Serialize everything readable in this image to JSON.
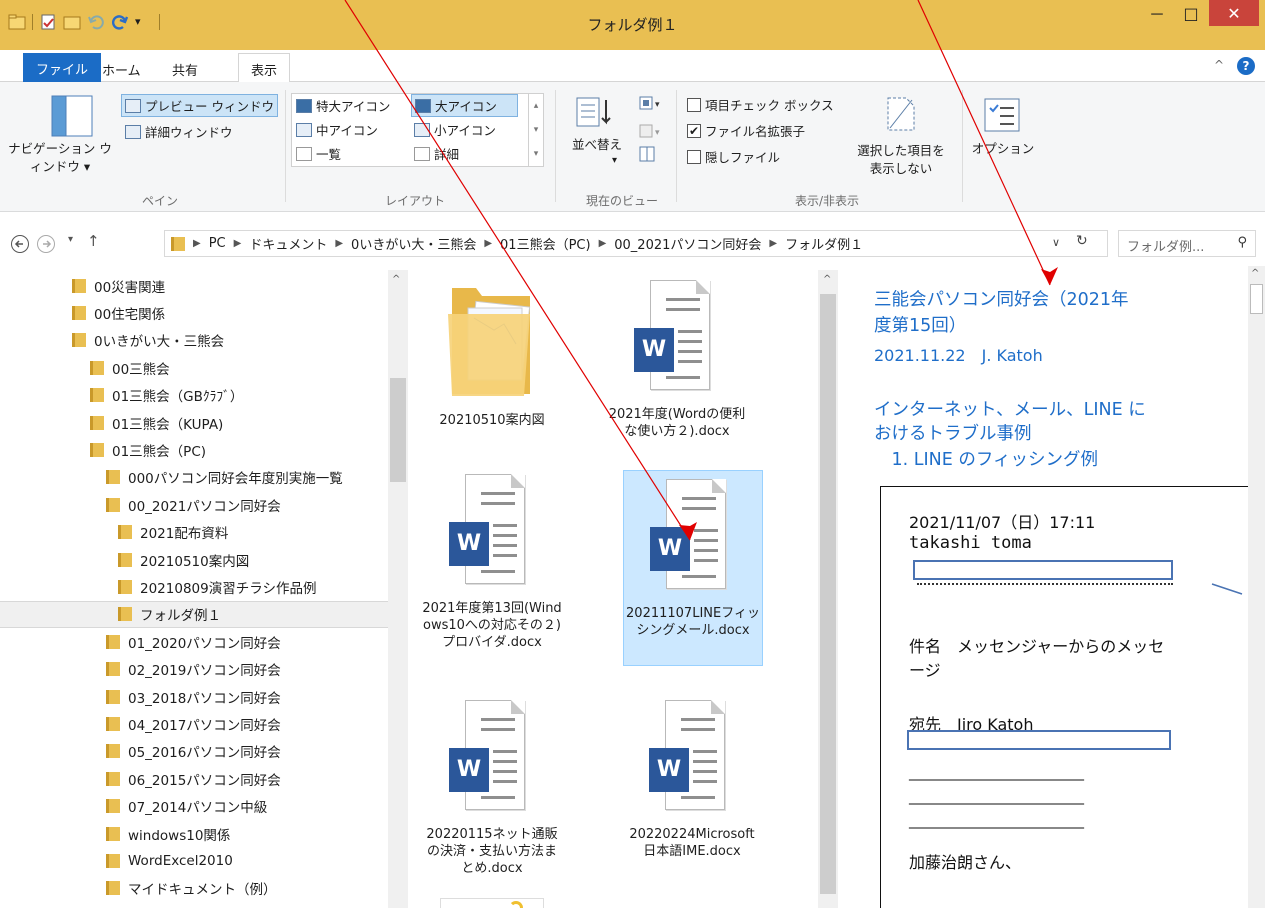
{
  "window": {
    "title": "フォルダ例１",
    "minimize": "－",
    "maximize": "□",
    "close": "✕"
  },
  "ribbon_tabs": {
    "file": "ファイル",
    "home": "ホーム",
    "share": "共有",
    "view": "表示",
    "collapse": "^",
    "help": "?"
  },
  "ribbon": {
    "pane_group": {
      "nav_pane": "ナビゲーション ウィンドウ ▾",
      "preview_pane": "プレビュー ウィンドウ",
      "details_pane": "詳細ウィンドウ",
      "label": "ペイン"
    },
    "layout_group": {
      "extra_large": "特大アイコン",
      "large": "大アイコン",
      "medium": "中アイコン",
      "small": "小アイコン",
      "list": "一覧",
      "details": "詳細",
      "label": "レイアウト"
    },
    "view_group": {
      "sort": "並べ替え",
      "label": "現在のビュー"
    },
    "showhide_group": {
      "item_checkboxes": "項目チェック ボックス",
      "file_extensions": "ファイル名拡張子",
      "hidden_files": "隠しファイル",
      "hide_selected_line1": "選択した項目を",
      "hide_selected_line2": "表示しない",
      "label": "表示/非表示",
      "item_checkboxes_checked": false,
      "file_extensions_checked": true,
      "hidden_files_checked": false
    },
    "options": "オプション"
  },
  "address": {
    "crumbs": [
      "PC",
      "ドキュメント",
      "0いきがい大・三熊会",
      "01三熊会（PC)",
      "00_2021パソコン同好会",
      "フォルダ例１"
    ],
    "search_placeholder": "フォルダ例..."
  },
  "nav_tree": [
    {
      "label": "00災害関連",
      "indent": 0
    },
    {
      "label": "00住宅関係",
      "indent": 0
    },
    {
      "label": "0いきがい大・三熊会",
      "indent": 0
    },
    {
      "label": "00三熊会",
      "indent": 1
    },
    {
      "label": "01三熊会（GBｸﾗﾌﾞ）",
      "indent": 1
    },
    {
      "label": "01三熊会（KUPA)",
      "indent": 1
    },
    {
      "label": "01三熊会（PC)",
      "indent": 1
    },
    {
      "label": "000パソコン同好会年度別実施一覧",
      "indent": 2
    },
    {
      "label": "00_2021パソコン同好会",
      "indent": 2
    },
    {
      "label": "2021配布資料",
      "indent": 3
    },
    {
      "label": "20210510案内図",
      "indent": 3
    },
    {
      "label": "20210809演習チラシ作品例",
      "indent": 3
    },
    {
      "label": "フォルダ例１",
      "indent": 3,
      "selected": true
    },
    {
      "label": "01_2020パソコン同好会",
      "indent": 2
    },
    {
      "label": "02_2019パソコン同好会",
      "indent": 2
    },
    {
      "label": "03_2018パソコン同好会",
      "indent": 2
    },
    {
      "label": "04_2017パソコン同好会",
      "indent": 2
    },
    {
      "label": "05_2016パソコン同好会",
      "indent": 2
    },
    {
      "label": "06_2015パソコン同好会",
      "indent": 2
    },
    {
      "label": "07_2014パソコン中級",
      "indent": 2
    },
    {
      "label": "windows10関係",
      "indent": 2
    },
    {
      "label": "WordExcel2010",
      "indent": 2
    },
    {
      "label": "マイドキュメント（例）",
      "indent": 2
    }
  ],
  "files": [
    {
      "name": "20210510案内図",
      "type": "folder"
    },
    {
      "name": "2021年度(Wordの便利な使い方２).docx",
      "type": "word"
    },
    {
      "name": "2021年度第13回(Windows10への対応その２)プロバイダ.docx",
      "type": "word"
    },
    {
      "name": "20211107LINEフィッシングメール.docx",
      "type": "word",
      "selected": true
    },
    {
      "name": "20220115ネット通販の決済・支払い方法まとめ.docx",
      "type": "word"
    },
    {
      "name": "20220224Microsoft 日本語IME.docx",
      "type": "word"
    }
  ],
  "preview": {
    "heading_line1": "三能会パソコン同好会（2021年",
    "heading_line2": "度第15回）",
    "date_line": "2021.11.22　J. Katoh",
    "topic_line1": "インターネット、メール、LINE に",
    "topic_line2": "おけるトラブル事例",
    "topic_line3": "　1. LINE のフィッシング例",
    "mail_date": "2021/11/07（日）17:11",
    "mail_from": "takashi toma",
    "mail_subject_line1": "件名　メッセンジャーからのメッセ",
    "mail_subject_line2": "ージ",
    "mail_to": "宛先　Jiro Katoh",
    "dash_line": "_____________________________",
    "greeting": "加藤治朗さん、"
  },
  "colors": {
    "titlebar": "#e9bf52",
    "file_tab": "#1b6cc6",
    "preview_text": "#1f6ec9",
    "word_blue": "#2b579a",
    "selection": "#cce8ff",
    "annotation": "#e00000"
  }
}
